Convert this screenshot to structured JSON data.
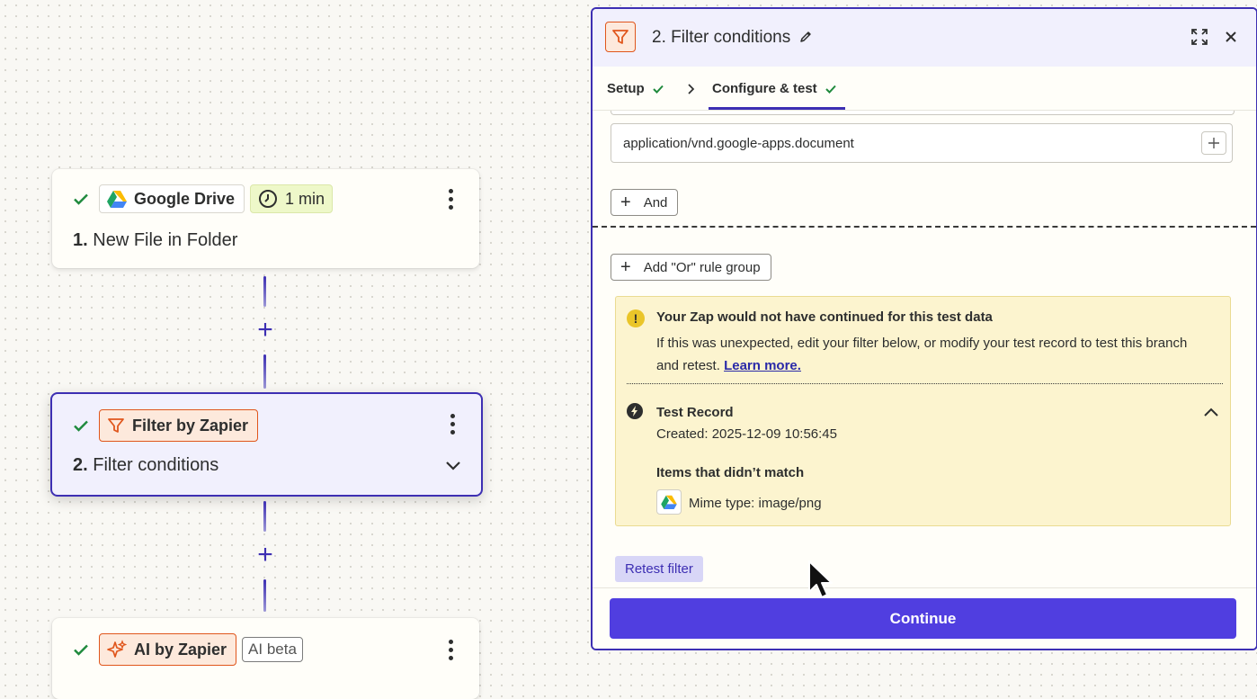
{
  "canvas": {
    "step1": {
      "app_name": "Google Drive",
      "trigger_time": "1 min",
      "number": "1.",
      "title": "New File in Folder"
    },
    "step2": {
      "app_name": "Filter by Zapier",
      "number": "2.",
      "title": "Filter conditions"
    },
    "step3": {
      "app_name": "AI by Zapier",
      "badge": "AI beta"
    }
  },
  "panel": {
    "number": "2.",
    "title": "Filter conditions",
    "tabs": [
      {
        "label": "Setup"
      },
      {
        "label": "Configure & test"
      }
    ],
    "condition_value": "application/vnd.google-apps.document",
    "and_label": "And",
    "or_group_label": "Add \"Or\" rule group",
    "alert": {
      "title": "Your Zap would not have continued for this test data",
      "body": "If this was unexpected, edit your filter below, or modify your test record to test this branch and retest.",
      "link": "Learn more.",
      "record_title": "Test Record",
      "created": "Created: 2025-12-09 10:56:45",
      "items_title": "Items that didn’t match",
      "mismatch": "Mime type: image/png"
    },
    "retest_label": "Retest filter",
    "continue_label": "Continue"
  },
  "colors": {
    "accent": "#3d2fb3",
    "primary_button": "#503ee0",
    "success": "#1f8a3d",
    "zapier_orange": "#e0561c",
    "warning_bg": "#fcf4cf"
  }
}
